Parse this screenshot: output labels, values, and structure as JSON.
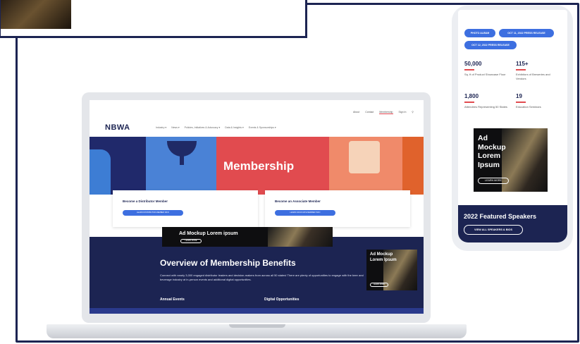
{
  "laptop": {
    "util_nav": [
      "About",
      "Contact",
      "Membership",
      "Sign In"
    ],
    "logo": "NBWA",
    "main_nav": [
      "Industry ▾",
      "News ▾",
      "Policies, Initiatives & Advocacy ▾",
      "Data & Insights ▾",
      "Events & Sponsorships ▾"
    ],
    "hero_title": "Membership",
    "cards": [
      {
        "title": "Become a Distributor Member",
        "button": "LEARN DISTRIBUTOR MEMBER INFO"
      },
      {
        "title": "Become an Associate Member",
        "button": "LEARN ASSOCIATE MEMBER INFO"
      }
    ],
    "ad_banner": {
      "title": "Ad Mockup Lorem ipsum",
      "button": "LEARN MORE"
    },
    "benefits": {
      "title": "Overview of Membership Benefits",
      "body": "Connect with nearly 3,000 engaged distributor leaders and decision-makers from across all 50 states! There are plenty of opportunities to engage with the beer and beverage industry at in-person events and additional digital opportunities.",
      "col1": "Annual Events",
      "col2": "Digital Opportunities"
    },
    "side_ad": {
      "title": "Ad Mockup Lorem Ipsum",
      "button": "LEARN MORE"
    }
  },
  "phone": {
    "pills": [
      "PHOTO ALBUM",
      "OCT 11, 2022 PRESS RELEASE",
      "OCT 12, 2022 PRESS RELEASE"
    ],
    "stats": [
      {
        "number": "50,000",
        "label": "Sq. ft of Product Showcase Floor"
      },
      {
        "number": "115+",
        "label": "Exhibitors of Breweries and Vendors"
      },
      {
        "number": "1,800",
        "label": "Attendees Representing 50 States"
      },
      {
        "number": "19",
        "label": "Education Seminars"
      }
    ],
    "ad": {
      "title": "Ad Mockup Lorem Ipsum",
      "button": "LEARN MORE"
    },
    "speakers": {
      "title": "2022 Featured Speakers",
      "button": "VIEW ALL SPEAKERS & BIOS"
    }
  },
  "colors": {
    "navy": "#1c2452",
    "accent_blue": "#3d6fe0",
    "accent_red": "#e14b4f"
  }
}
